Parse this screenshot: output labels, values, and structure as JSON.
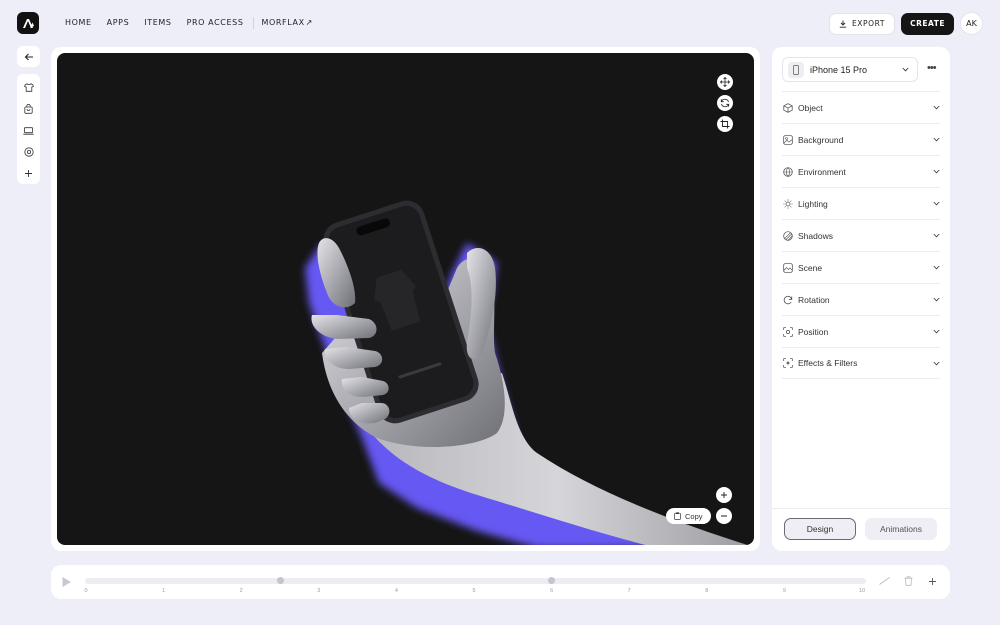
{
  "nav": {
    "items": [
      "HOME",
      "APPS",
      "ITEMS",
      "PRO ACCESS"
    ],
    "external": "MORFLAX",
    "external_icon": "arrow-up-right-icon"
  },
  "header": {
    "export_label": "EXPORT",
    "create_label": "CREATE",
    "avatar_initials": "AK"
  },
  "toolbar": {
    "icons": [
      "back-arrow-icon",
      "tshirt-icon",
      "bag-icon",
      "laptop-icon",
      "target-icon",
      "plus-icon"
    ]
  },
  "canvas": {
    "background": "#151515",
    "copy_label": "Copy",
    "glow_color": "#6c5cf6"
  },
  "panel": {
    "device": "iPhone 15 Pro",
    "sections": [
      {
        "label": "Object",
        "icon": "cube-icon"
      },
      {
        "label": "Background",
        "icon": "image-icon"
      },
      {
        "label": "Environment",
        "icon": "globe-icon"
      },
      {
        "label": "Lighting",
        "icon": "sun-icon"
      },
      {
        "label": "Shadows",
        "icon": "shadow-icon"
      },
      {
        "label": "Scene",
        "icon": "landscape-icon"
      },
      {
        "label": "Rotation",
        "icon": "rotate-icon"
      },
      {
        "label": "Position",
        "icon": "focus-icon"
      },
      {
        "label": "Effects & Filters",
        "icon": "effects-icon"
      }
    ],
    "tabs": {
      "design": "Design",
      "animations": "Animations"
    }
  },
  "timeline": {
    "ticks": [
      "0",
      "1",
      "2",
      "3",
      "4",
      "5",
      "6",
      "7",
      "8",
      "9",
      "10"
    ],
    "keyframes": [
      2.5,
      6.0
    ]
  }
}
